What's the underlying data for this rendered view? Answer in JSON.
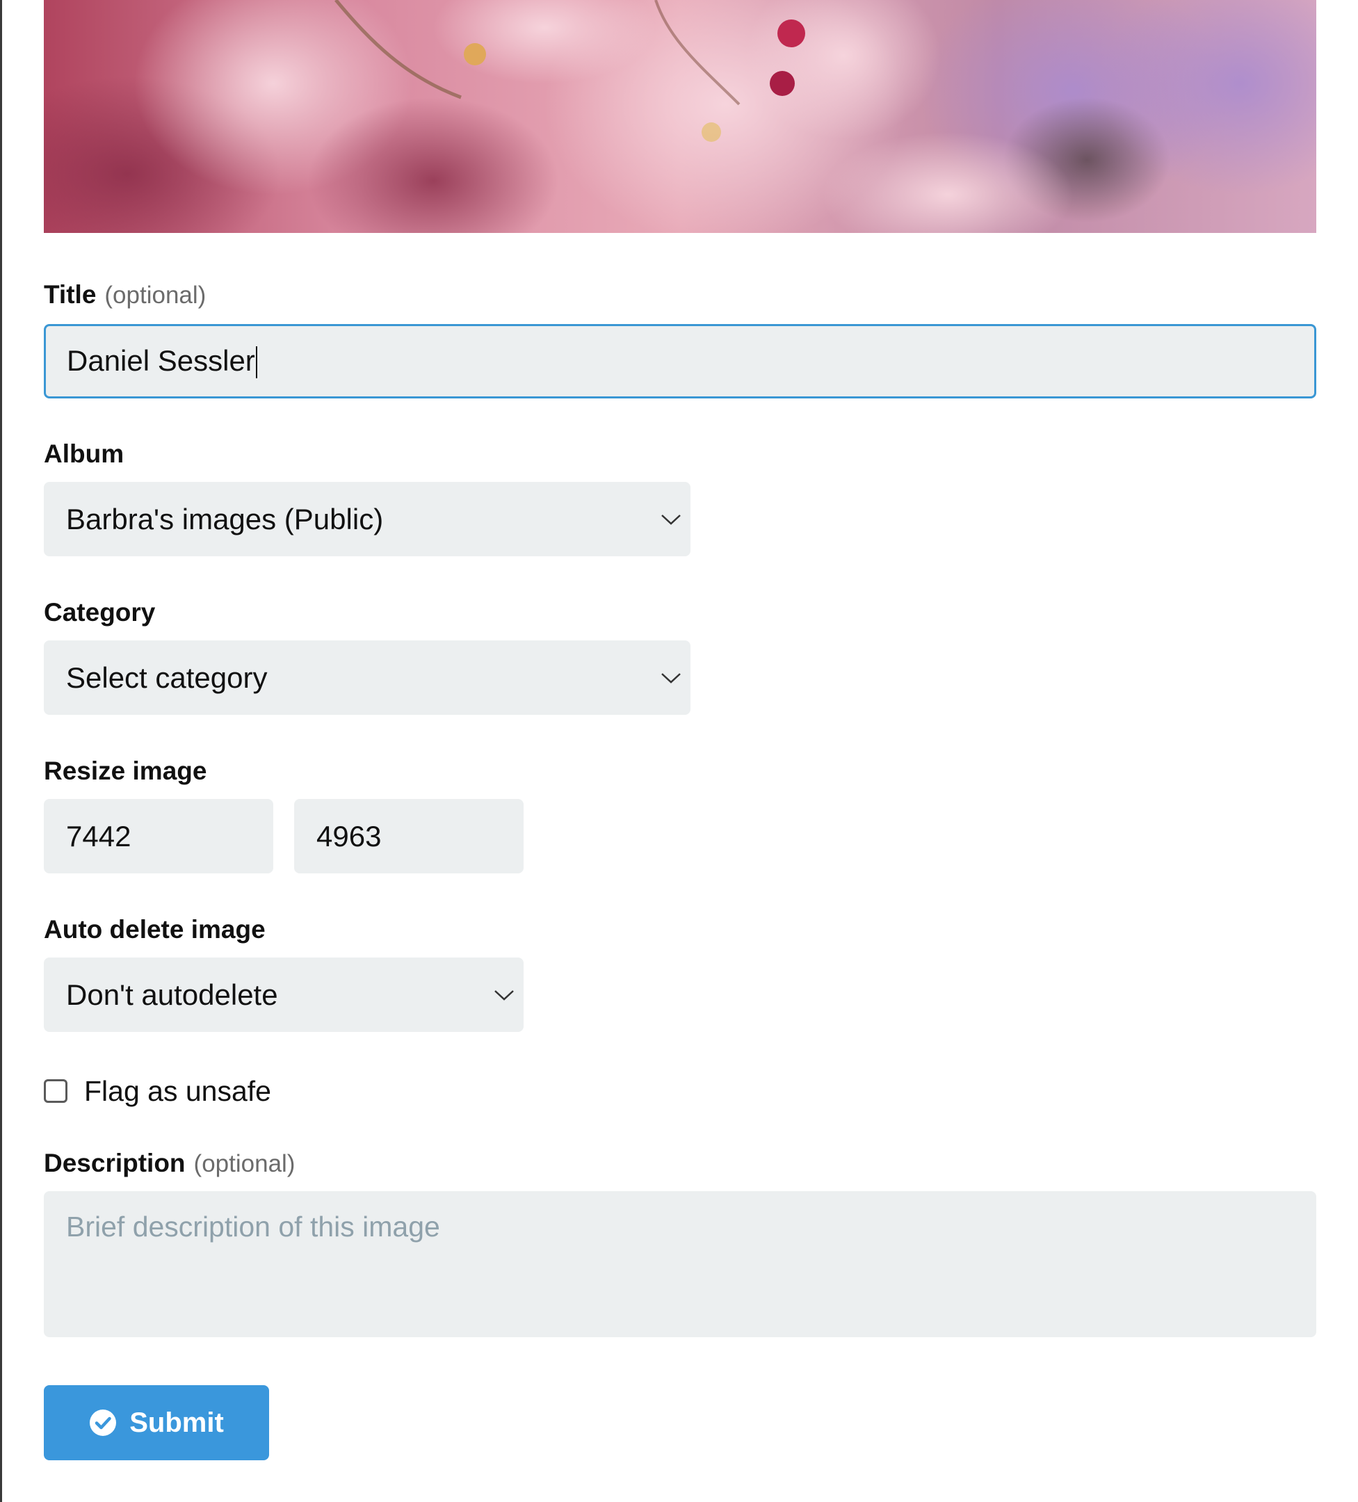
{
  "form": {
    "title_label": "Title",
    "title_optional": "(optional)",
    "title_value": "Daniel Sessler",
    "album_label": "Album",
    "album_value": "Barbra's images (Public)",
    "category_label": "Category",
    "category_value": "Select category",
    "resize_label": "Resize image",
    "resize_width": "7442",
    "resize_height": "4963",
    "autodelete_label": "Auto delete image",
    "autodelete_value": "Don't autodelete",
    "flag_label": "Flag as unsafe",
    "flag_checked": false,
    "description_label": "Description",
    "description_optional": "(optional)",
    "description_placeholder": "Brief description of this image",
    "submit_label": "Submit"
  },
  "colors": {
    "accent": "#3a97dc",
    "field_bg": "#eceff0",
    "focus_border": "#3a97d4",
    "placeholder": "#8fa1ab"
  },
  "icons": {
    "select_arrow": "chevron-down-icon",
    "submit": "check-circle-icon"
  }
}
